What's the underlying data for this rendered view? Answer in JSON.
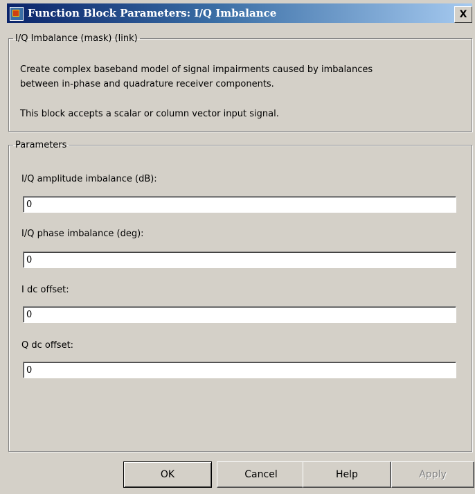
{
  "window": {
    "title": "Function Block Parameters: I/Q Imbalance",
    "close_label": "X"
  },
  "description_group": {
    "legend": "I/Q Imbalance (mask) (link)",
    "lines": [
      "Create complex baseband model of signal impairments caused by imbalances",
      "between in-phase and quadrature receiver components.",
      "This block accepts a scalar or column vector input signal."
    ]
  },
  "parameters_group": {
    "legend": "Parameters",
    "fields": [
      {
        "label": "I/Q amplitude imbalance (dB):",
        "value": "0"
      },
      {
        "label": "I/Q phase imbalance (deg):",
        "value": "0"
      },
      {
        "label": "I dc offset:",
        "value": "0"
      },
      {
        "label": "Q dc offset:",
        "value": "0"
      }
    ]
  },
  "buttons": {
    "ok": "OK",
    "cancel": "Cancel",
    "help": "Help",
    "apply": "Apply"
  }
}
